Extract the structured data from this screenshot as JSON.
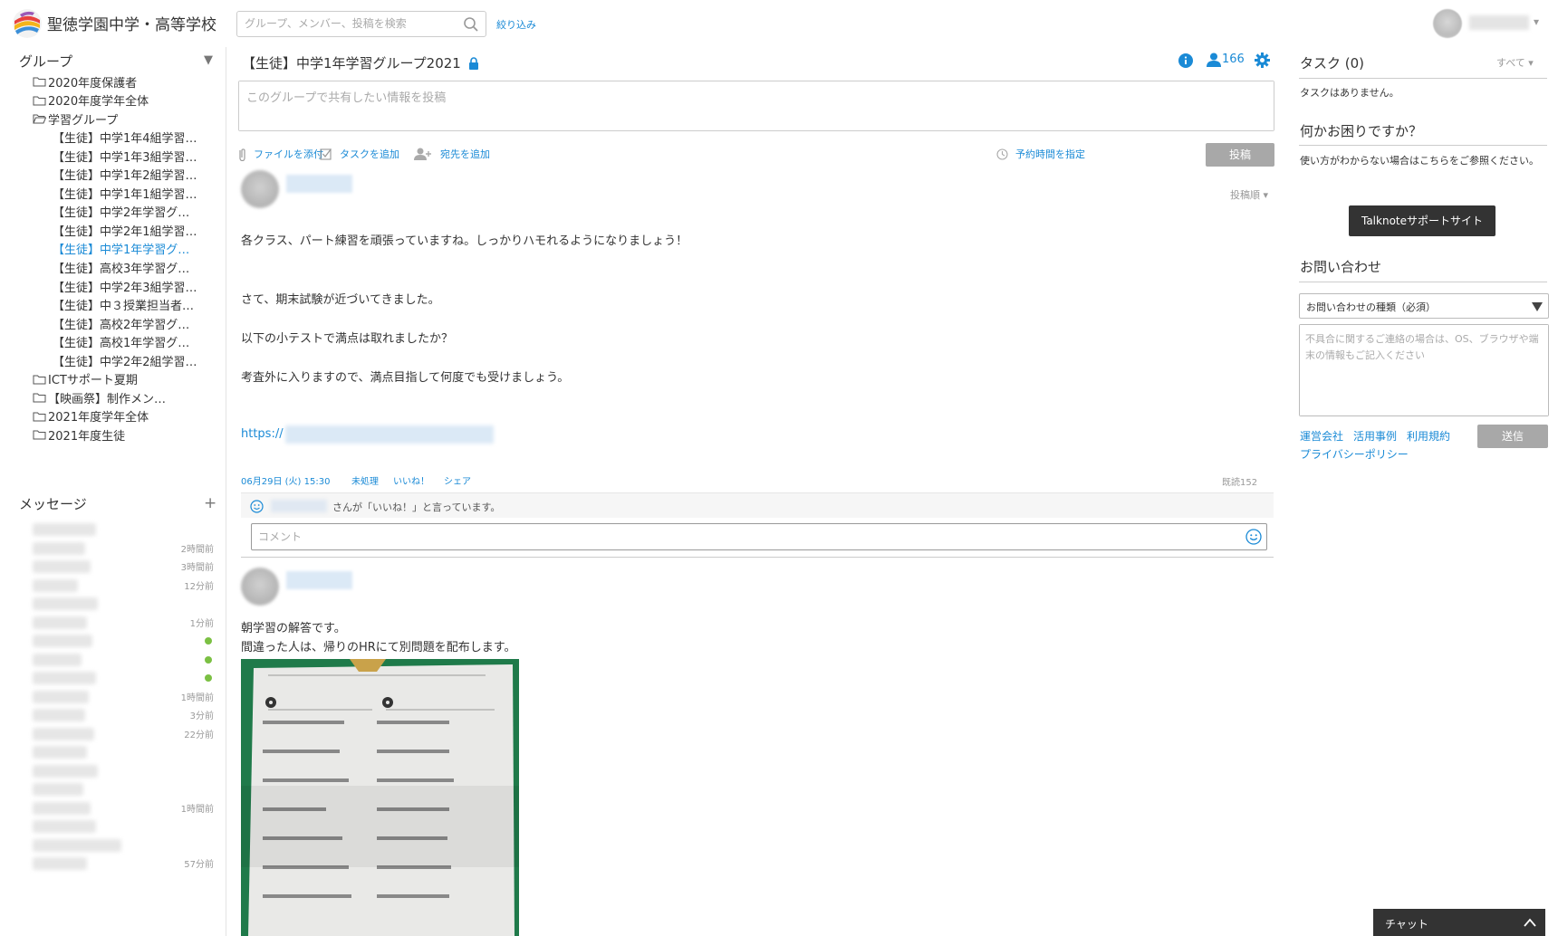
{
  "header": {
    "school_name": "聖徳学園中学・高等学校",
    "search_placeholder": "グループ、メンバー、投稿を検索",
    "filter_label": "絞り込み"
  },
  "sidebar": {
    "groups_title": "グループ",
    "groups_toggle": "▼",
    "folders_top": [
      "2020年度保護者",
      "2020年度学年全体",
      "学習グループ"
    ],
    "subgroups": [
      "【生徒】中学1年4組学習…",
      "【生徒】中学1年3組学習…",
      "【生徒】中学1年2組学習…",
      "【生徒】中学1年1組学習…",
      "【生徒】中学2年学習グ…",
      "【生徒】中学2年1組学習…",
      "【生徒】中学1年学習グ…",
      "【生徒】高校3年学習グ…",
      "【生徒】中学2年3組学習…",
      "【生徒】中３授業担当者…",
      "【生徒】高校2年学習グ…",
      "【生徒】高校1年学習グ…",
      "【生徒】中学2年2組学習…"
    ],
    "active_index": 6,
    "folders_bottom": [
      "ICTサポート夏期",
      "【映画祭】制作メン…",
      "2021年度学年全体",
      "2021年度生徒"
    ],
    "messages_title": "メッセージ",
    "messages_add": "+",
    "message_times": [
      "",
      "2時間前",
      "3時間前",
      "12分前",
      "",
      "1分前",
      "",
      "",
      "",
      "1時間前",
      "3分前",
      "22分前",
      "",
      "",
      "",
      "1時間前",
      "",
      "",
      "57分前"
    ]
  },
  "main": {
    "group_title": "【生徒】中学1年学習グループ2021",
    "member_count": "166",
    "post_placeholder": "このグループで共有したい情報を投稿",
    "tools": {
      "attach": "ファイルを添付",
      "task": "タスクを追加",
      "recipient": "宛先を追加",
      "schedule": "予約時間を指定"
    },
    "post_button": "投稿",
    "sort_label": "投稿順 ▾",
    "post1": {
      "line1": "各クラス、パート練習を頑張っていますね。しっかりハモれるようになりましょう！",
      "line2": "さて、期末試験が近づいてきました。",
      "line3": "以下の小テストで満点は取れましたか？",
      "line4": "考査外に入りますので、満点目指して何度でも受けましょう。",
      "link": "https://",
      "date": "06月29日 (火) 15:30",
      "status": "未処理",
      "like": "いいね！",
      "share": "シェア",
      "read": "既読152",
      "like_text": "さんが「いいね！」と言っています。",
      "comment_placeholder": "コメント"
    },
    "post2": {
      "line1": "朝学習の解答です。",
      "line2": "間違った人は、帰りのHRにて別問題を配布します。"
    }
  },
  "right": {
    "tasks_title": "タスク (0)",
    "tasks_filter": "すべて ▾",
    "no_tasks": "タスクはありません。",
    "help_title": "何かお困りですか？",
    "help_text": "使い方がわからない場合はこちらをご参照ください。",
    "support_button": "Talknoteサポートサイト",
    "contact_title": "お問い合わせ",
    "contact_select": "お問い合わせの種類（必須）",
    "contact_placeholder": "不具合に関するご連絡の場合は、OS、ブラウザや端末の情報もご記入ください",
    "send_button": "送信",
    "links": [
      "運営会社",
      "活用事例",
      "利用規約",
      "プライバシーポリシー"
    ],
    "chat_label": "チャット"
  },
  "colors": {
    "accent": "#1a8ad6",
    "presence": "#7bc043",
    "button_gray": "#a8a8a8"
  }
}
